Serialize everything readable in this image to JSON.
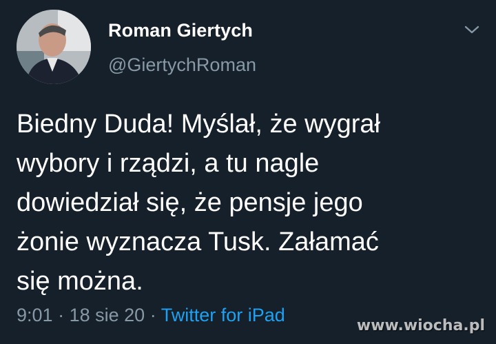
{
  "tweet": {
    "author": {
      "display_name": "Roman Giertych",
      "handle": "@GiertychRoman",
      "avatar_icon": "profile-photo"
    },
    "menu_icon": "chevron-down-icon",
    "text_lines": [
      "Biedny Duda! Myślał, że wygrał",
      "wybory i rządzi, a tu nagle",
      "dowiedział się, że pensje jego",
      "żonie wyznacza Tusk. Załamać",
      "się można."
    ],
    "meta": {
      "time": "9:01",
      "separator": "·",
      "date": "18 sie 20",
      "source": "Twitter for iPad"
    },
    "watermark": "www.wiocha.pl",
    "colors": {
      "background": "#15202b",
      "text": "#ffffff",
      "secondary": "#8899a6",
      "link": "#1da1f2"
    }
  }
}
